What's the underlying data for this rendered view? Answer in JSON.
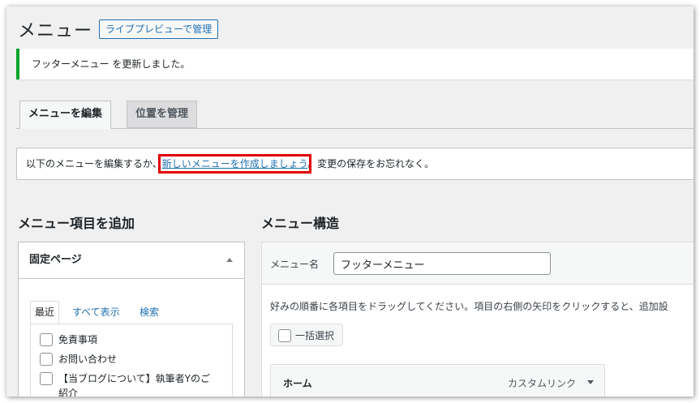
{
  "header": {
    "title": "メニュー",
    "preview_button": "ライブプレビューで管理"
  },
  "notice": {
    "text": "フッターメニュー を更新しました。"
  },
  "tabs": [
    {
      "label": "メニューを編集"
    },
    {
      "label": "位置を管理"
    }
  ],
  "manage": {
    "before": "以下のメニューを編集するか、",
    "link": "新しいメニューを作成しましょう",
    "after": "。変更の保存をお忘れなく。"
  },
  "add_items": {
    "heading": "メニュー項目を追加",
    "panel_title": "固定ページ",
    "subtabs": [
      "最近",
      "すべて表示",
      "検索"
    ],
    "pages": [
      "免責事項",
      "お問い合わせ",
      "【当ブログについて】執筆者Yのご",
      "紹介"
    ]
  },
  "structure": {
    "heading": "メニュー構造",
    "name_label": "メニュー名",
    "name_value": "フッターメニュー",
    "instructions": "好みの順番に各項目をドラッグしてください。項目の右側の矢印をクリックすると、追加設",
    "bulk_select": "一括選択",
    "items": [
      {
        "title": "ホーム",
        "type": "カスタムリンク"
      }
    ]
  },
  "colors": {
    "accent": "#2271b1",
    "notice_success": "#00a32a",
    "highlight": "#e00000"
  }
}
